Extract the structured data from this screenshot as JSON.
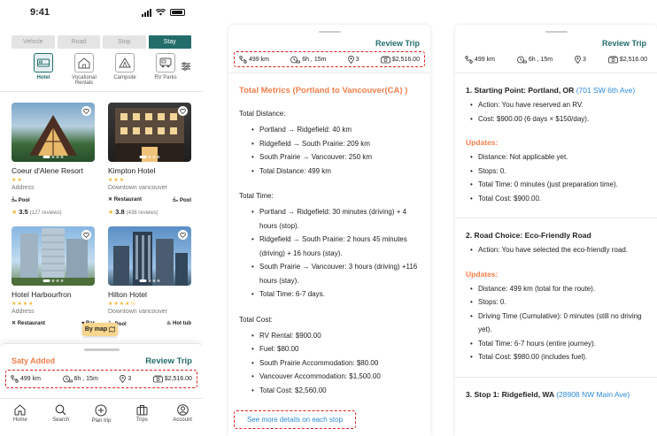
{
  "status": {
    "time": "9:41"
  },
  "segments": [
    {
      "label": "Vehicle",
      "active": false
    },
    {
      "label": "Road",
      "active": false
    },
    {
      "label": "Stop",
      "active": false
    },
    {
      "label": "Stay",
      "active": true
    }
  ],
  "categories": [
    {
      "label": "Hotel",
      "icon": "hotel-icon"
    },
    {
      "label": "Vocational Rentals",
      "icon": "house-icon"
    },
    {
      "label": "Campsite",
      "icon": "tent-icon"
    },
    {
      "label": "RV Parks",
      "icon": "rv-icon"
    }
  ],
  "hotels": [
    {
      "name": "Coeur d'Alene Resort",
      "stars": "★★",
      "address": "Address",
      "amenities": [
        "Pool"
      ],
      "rating": "3.5",
      "reviews": "(127 reviews)"
    },
    {
      "name": "Kimpton Hotel",
      "stars": "★★★",
      "address": "Downtown vancouver",
      "amenities": [
        "Restaurant",
        "Pool"
      ],
      "rating": "3.8",
      "reviews": "(438 reviews)"
    },
    {
      "name": "Hotel Harbourfron",
      "stars": "★★★★",
      "address": "Address",
      "amenities": [
        "Restaurant",
        "Bar"
      ]
    },
    {
      "name": "Hilton Hotel",
      "stars": "★★★★½",
      "address": "Downtown vancouver",
      "amenities": [
        "Pool",
        "Hot tub"
      ]
    }
  ],
  "by_map": "By map",
  "sheet": {
    "title": "Saty Added",
    "review": "Review Trip"
  },
  "metrics": {
    "distance": "499 km",
    "time": "6h , 15m",
    "stops": "3",
    "cost": "$2,516.00"
  },
  "tabs": [
    {
      "label": "Home",
      "icon": "home-icon"
    },
    {
      "label": "Search",
      "icon": "search-icon"
    },
    {
      "label": "Plan trip",
      "icon": "plus-circle-icon"
    },
    {
      "label": "Trips",
      "icon": "luggage-icon"
    },
    {
      "label": "Account",
      "icon": "user-icon"
    }
  ],
  "review_panel": {
    "review": "Review Trip",
    "title": "Total Metrics (Portland to Vancouver(CA) )",
    "sections": [
      {
        "heading": "Total Distance:",
        "items": [
          "Portland → Ridgefield: 40 km",
          "Ridgefield → South Prairie: 209 km",
          "South Prairie → Vancouver: 250 km",
          "Total Distance: 499 km"
        ]
      },
      {
        "heading": "Total Time:",
        "items": [
          "Portland → Ridgefield: 30 minutes (driving) + 4 hours (stop).",
          "Ridgefield → South Prairie: 2 hours 45 minutes (driving) + 16 hours (stay).",
          "South Prairie → Vancouver: 3 hours (driving) +116 hours (stay).",
          "Total Time: 6-7 days."
        ]
      },
      {
        "heading": "Total Cost:",
        "items": [
          "RV Rental: $900.00",
          "Fuel: $80.00",
          "South Prairie Accommodation: $80.00",
          "Vancouver Accommodation: $1,500.00",
          "Total Cost: $2,560.00"
        ]
      }
    ],
    "see_more": "See more details on each stop"
  },
  "details_panel": {
    "review": "Review Trip",
    "step1": {
      "title": "1. Starting Point: Portland, OR",
      "addr": "(701 SW 6th Ave)",
      "items": [
        "Action: You have reserved an RV.",
        "Cost: $900.00 (6 days × $150/day)."
      ]
    },
    "updates_label": "Updates:",
    "upd1": [
      "Distance: Not applicable yet.",
      "Stops: 0.",
      "Total Time: 0 minutes (just preparation time).",
      "Total Cost: $900.00."
    ],
    "step2": {
      "title": "2. Road Choice: Eco-Friendly Road",
      "items": [
        "Action: You have selected the eco-friendly road."
      ]
    },
    "upd2": [
      "Distance: 499 km (total for the route).",
      "Stops: 0.",
      "Driving Time (Cumulative): 0 minutes (still no driving yet).",
      "Total Time: 6-7 hours (entire journey).",
      "Total Cost: $980.00 (includes fuel)."
    ],
    "step3": {
      "title": "3. Stop 1: Ridgefield, WA",
      "addr": "(28908 NW Main Ave)"
    }
  }
}
